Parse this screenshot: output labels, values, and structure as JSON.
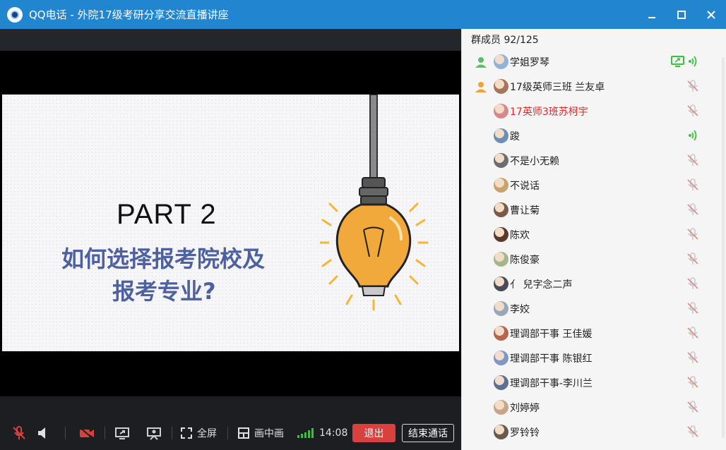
{
  "window": {
    "title": "QQ电话 - 外院17级考研分享交流直播讲座",
    "min_icon": "minimize-icon",
    "max_icon": "maximize-icon",
    "close_icon": "close-icon"
  },
  "slide": {
    "heading": "PART 2",
    "line1": "如何选择报考院校及",
    "line2": "报考专业?"
  },
  "toolbar": {
    "fullscreen_label": "全屏",
    "pip_label": "画中画",
    "time": "14:08",
    "exit_label": "退出",
    "end_call_label": "结束通话",
    "signal_color": "#35c23c"
  },
  "members": {
    "count_label": "群成员 92/125",
    "list": [
      {
        "name": "学姐罗琴",
        "role": "admin",
        "status": "speaking",
        "screen_share": true,
        "red": false
      },
      {
        "name": "17级英师三班 兰友卓",
        "role": "owner",
        "status": "muted",
        "screen_share": false,
        "red": false
      },
      {
        "name": "17英师3班苏柯宇",
        "role": "",
        "status": "muted",
        "screen_share": false,
        "red": true
      },
      {
        "name": "踆",
        "role": "",
        "status": "speaking",
        "screen_share": false,
        "red": false
      },
      {
        "name": "不是小无赖",
        "role": "",
        "status": "muted",
        "screen_share": false,
        "red": false
      },
      {
        "name": "不说话",
        "role": "",
        "status": "muted",
        "screen_share": false,
        "red": false
      },
      {
        "name": "曹让菊",
        "role": "",
        "status": "muted",
        "screen_share": false,
        "red": false
      },
      {
        "name": "陈欢",
        "role": "",
        "status": "muted",
        "screen_share": false,
        "red": false
      },
      {
        "name": "陈俊豪",
        "role": "",
        "status": "muted",
        "screen_share": false,
        "red": false
      },
      {
        "name": "亻 兒字念二声",
        "role": "",
        "status": "muted",
        "screen_share": false,
        "red": false
      },
      {
        "name": "李姣",
        "role": "",
        "status": "muted",
        "screen_share": false,
        "red": false
      },
      {
        "name": "理调部干事  王佳媛",
        "role": "",
        "status": "muted",
        "screen_share": false,
        "red": false
      },
      {
        "name": "理调部干事 陈银红",
        "role": "",
        "status": "muted",
        "screen_share": false,
        "red": false
      },
      {
        "name": "理调部干事-李川兰",
        "role": "",
        "status": "muted",
        "screen_share": false,
        "red": false
      },
      {
        "name": "刘婷婷",
        "role": "",
        "status": "muted",
        "screen_share": false,
        "red": false
      },
      {
        "name": "罗铃铃",
        "role": "",
        "status": "muted",
        "screen_share": false,
        "red": false
      }
    ]
  },
  "colors": {
    "titlebar": "#2185d0",
    "slide_text": "#4d60a0",
    "exit_button": "#d9413c",
    "speaking": "#3cbf3c",
    "muted": "#c9c9c9",
    "role_owner": "#f0a23a",
    "role_admin": "#5bbf6a"
  }
}
